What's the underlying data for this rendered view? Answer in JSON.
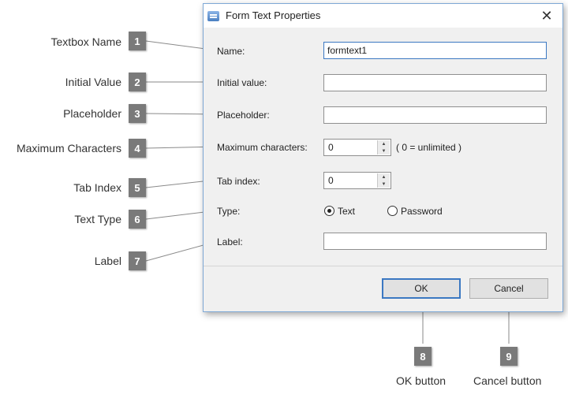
{
  "dialog": {
    "title": "Form Text Properties",
    "close_glyph": "✕",
    "fields": {
      "name": {
        "label": "Name:",
        "value": "formtext1"
      },
      "initial_value": {
        "label": "Initial value:",
        "value": ""
      },
      "placeholder": {
        "label": "Placeholder:",
        "value": ""
      },
      "max_chars": {
        "label": "Maximum characters:",
        "value": "0",
        "hint": "( 0 = unlimited )"
      },
      "tab_index": {
        "label": "Tab index:",
        "value": "0"
      },
      "type": {
        "label": "Type:",
        "options": [
          "Text",
          "Password"
        ],
        "selected": "Text"
      },
      "label": {
        "label": "Label:",
        "value": ""
      }
    },
    "ok_label": "OK",
    "cancel_label": "Cancel"
  },
  "callouts": [
    {
      "number": "1",
      "text": "Textbox Name"
    },
    {
      "number": "2",
      "text": "Initial Value"
    },
    {
      "number": "3",
      "text": "Placeholder"
    },
    {
      "number": "4",
      "text": "Maximum Characters"
    },
    {
      "number": "5",
      "text": "Tab Index"
    },
    {
      "number": "6",
      "text": "Text Type"
    },
    {
      "number": "7",
      "text": "Label"
    },
    {
      "number": "8",
      "text": "OK button"
    },
    {
      "number": "9",
      "text": "Cancel button"
    }
  ],
  "colors": {
    "badge": "#7a7a7a",
    "accent": "#3b78c2",
    "dialog_bg": "#f0f0f0"
  },
  "icons": {
    "title": "dialog-app-icon",
    "close": "close-icon",
    "spin_up": "spin-up-arrow-icon",
    "spin_down": "spin-down-arrow-icon"
  }
}
